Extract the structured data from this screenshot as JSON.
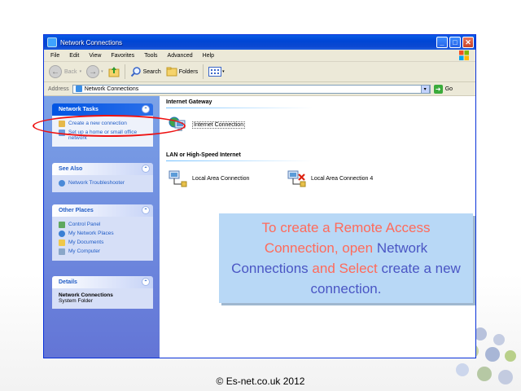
{
  "window": {
    "title": "Network Connections",
    "minimize_glyph": "_",
    "maximize_glyph": "□",
    "close_glyph": "✕"
  },
  "menu": {
    "items": [
      "File",
      "Edit",
      "View",
      "Favorites",
      "Tools",
      "Advanced",
      "Help"
    ]
  },
  "toolbar": {
    "back_label": "Back",
    "back_glyph": "←",
    "forward_glyph": "→",
    "search_label": "Search",
    "folders_label": "Folders"
  },
  "address": {
    "label": "Address",
    "value": "Network Connections",
    "go_label": "Go"
  },
  "taskpane": {
    "network_tasks": {
      "title": "Network Tasks",
      "items": [
        "Create a new connection",
        "Set up a home or small office network"
      ]
    },
    "see_also": {
      "title": "See Also",
      "items": [
        "Network Troubleshooter"
      ]
    },
    "other_places": {
      "title": "Other Places",
      "items": [
        "Control Panel",
        "My Network Places",
        "My Documents",
        "My Computer"
      ]
    },
    "details": {
      "title": "Details",
      "name": "Network Connections",
      "subtitle": "System Folder"
    },
    "collapse_glyph": "⌃"
  },
  "content": {
    "gateway_header": "Internet Gateway",
    "gateway_item": "Internet Connection",
    "lan_header": "LAN or High-Speed Internet",
    "lan_items": [
      "Local Area Connection",
      "Local Area Connection 4"
    ]
  },
  "callout": {
    "part1": "To create a Remote Access Connection, open ",
    "part2": "Network Connections",
    "part3": " and Select ",
    "part4": "create a new connection."
  },
  "footer": {
    "copyright": "© Es-net.co.uk 2012"
  },
  "colors": {
    "titlebar": "#0054e3",
    "taskpane": "#7ba2e7",
    "callout_bg": "#b8d8f6",
    "callout_red": "#ff6a5a",
    "callout_blue": "#4a56c4",
    "annotation_red": "#e11111"
  }
}
